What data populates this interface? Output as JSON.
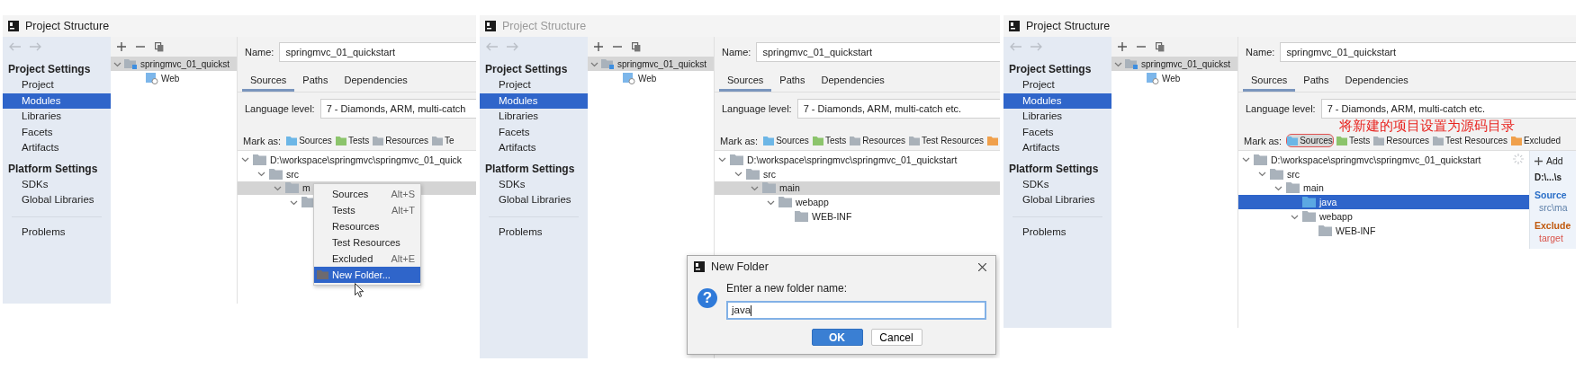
{
  "windows": [
    {
      "title": "Project Structure",
      "active": true,
      "tree_focused": false,
      "sidebar": {
        "sections": [
          {
            "heading": "Project Settings",
            "items": [
              {
                "label": "Project",
                "selected": false
              },
              {
                "label": "Modules",
                "selected": true
              },
              {
                "label": "Libraries",
                "selected": false
              },
              {
                "label": "Facets",
                "selected": false
              },
              {
                "label": "Artifacts",
                "selected": false
              }
            ]
          },
          {
            "heading": "Platform Settings",
            "items": [
              {
                "label": "SDKs",
                "selected": false
              },
              {
                "label": "Global Libraries",
                "selected": false
              }
            ]
          }
        ],
        "bottom_items": [
          {
            "label": "Problems",
            "selected": false
          }
        ]
      },
      "modules": [
        {
          "label": "springmvc_01_quickst",
          "kind": "module",
          "selected": true,
          "expanded": true,
          "children": [
            {
              "label": "Web",
              "kind": "web",
              "selected": false
            }
          ]
        }
      ],
      "name_label": "Name:",
      "name_value": "springmvc_01_quickstart",
      "tabs": [
        {
          "label": "Sources",
          "selected": true
        },
        {
          "label": "Paths",
          "selected": false
        },
        {
          "label": "Dependencies",
          "selected": false
        }
      ],
      "language_level_label": "Language level:",
      "language_level": "7 - Diamonds, ARM, multi-catch",
      "mark_as_label": "Mark as:",
      "mark_as": [
        {
          "label": "Sources",
          "color": "#6cb6e6",
          "circled": false
        },
        {
          "label": "Tests",
          "color": "#8cc46c",
          "circled": false
        },
        {
          "label": "Resources",
          "color": "#a9b1b9",
          "circled": false
        },
        {
          "label": "Te",
          "color": "#a9b1b9",
          "circled": false
        }
      ],
      "content_tree": [
        {
          "label": "D:\\workspace\\springmvc\\springmvc_01_quick",
          "kind": "folder",
          "expanded": true,
          "selected": false,
          "children": [
            {
              "label": "src",
              "kind": "folder",
              "expanded": true,
              "selected": false,
              "children": [
                {
                  "label": "m",
                  "kind": "folder",
                  "expanded": true,
                  "selected": true,
                  "children": [
                    {
                      "kind": "folder",
                      "expanded": true,
                      "selected": false
                    }
                  ]
                }
              ]
            }
          ]
        }
      ],
      "context_menu": {
        "items": [
          {
            "label": "Sources",
            "shortcut": "Alt+S",
            "kind": "mark",
            "selected": false
          },
          {
            "label": "Tests",
            "shortcut": "Alt+T",
            "kind": "mark",
            "selected": false
          },
          {
            "label": "Resources",
            "kind": "mark",
            "selected": false
          },
          {
            "label": "Test Resources",
            "kind": "mark",
            "selected": false
          },
          {
            "label": "Excluded",
            "shortcut": "Alt+E",
            "kind": "mark",
            "selected": false
          },
          {
            "label": "New Folder...",
            "kind": "create",
            "selected": true
          }
        ]
      }
    },
    {
      "title": "Project Structure",
      "active": false,
      "tree_focused": false,
      "sidebar": {
        "sections": [
          {
            "heading": "Project Settings",
            "items": [
              {
                "label": "Project",
                "selected": false
              },
              {
                "label": "Modules",
                "selected": true
              },
              {
                "label": "Libraries",
                "selected": false
              },
              {
                "label": "Facets",
                "selected": false
              },
              {
                "label": "Artifacts",
                "selected": false
              }
            ]
          },
          {
            "heading": "Platform Settings",
            "items": [
              {
                "label": "SDKs",
                "selected": false
              },
              {
                "label": "Global Libraries",
                "selected": false
              }
            ]
          }
        ],
        "bottom_items": [
          {
            "label": "Problems",
            "selected": false
          }
        ]
      },
      "modules": [
        {
          "label": "springmvc_01_quickst",
          "kind": "module",
          "selected": true,
          "expanded": true,
          "children": [
            {
              "label": "Web",
              "kind": "web",
              "selected": false
            }
          ]
        }
      ],
      "name_label": "Name:",
      "name_value": "springmvc_01_quickstart",
      "tabs": [
        {
          "label": "Sources",
          "selected": true
        },
        {
          "label": "Paths",
          "selected": false
        },
        {
          "label": "Dependencies",
          "selected": false
        }
      ],
      "language_level_label": "Language level:",
      "language_level": "7 - Diamonds, ARM, multi-catch etc.",
      "mark_as_label": "Mark as:",
      "mark_as": [
        {
          "label": "Sources",
          "color": "#6cb6e6",
          "circled": false
        },
        {
          "label": "Tests",
          "color": "#8cc46c",
          "circled": false
        },
        {
          "label": "Resources",
          "color": "#a9b1b9",
          "circled": false
        },
        {
          "label": "Test Resources",
          "color": "#a9b1b9",
          "circled": false
        },
        {
          "color": "#f0a04b",
          "circled": false
        }
      ],
      "content_tree": [
        {
          "label": "D:\\workspace\\springmvc\\springmvc_01_quickstart",
          "kind": "folder",
          "expanded": true,
          "selected": false,
          "children": [
            {
              "label": "src",
              "kind": "folder",
              "expanded": true,
              "selected": false,
              "children": [
                {
                  "label": "main",
                  "kind": "folder",
                  "expanded": true,
                  "selected": true,
                  "children": [
                    {
                      "label": "webapp",
                      "kind": "folder",
                      "expanded": true,
                      "selected": false,
                      "children": [
                        {
                          "label": "WEB-INF",
                          "kind": "folder",
                          "selected": false
                        }
                      ]
                    }
                  ]
                }
              ]
            }
          ]
        }
      ],
      "dialog": {
        "title": "New Folder",
        "icon": "?",
        "prompt": "Enter a new folder name:",
        "value": "java",
        "buttons": [
          {
            "label": "OK",
            "default": true
          },
          {
            "label": "Cancel",
            "default": false
          }
        ]
      }
    },
    {
      "title": "Project Structure",
      "active": true,
      "tree_focused": true,
      "busy": true,
      "sidebar": {
        "sections": [
          {
            "heading": "Project Settings",
            "items": [
              {
                "label": "Project",
                "selected": false
              },
              {
                "label": "Modules",
                "selected": true
              },
              {
                "label": "Libraries",
                "selected": false
              },
              {
                "label": "Facets",
                "selected": false
              },
              {
                "label": "Artifacts",
                "selected": false
              }
            ]
          },
          {
            "heading": "Platform Settings",
            "items": [
              {
                "label": "SDKs",
                "selected": false
              },
              {
                "label": "Global Libraries",
                "selected": false
              }
            ]
          }
        ],
        "bottom_items": [
          {
            "label": "Problems",
            "selected": false
          }
        ]
      },
      "modules": [
        {
          "label": "springmvc_01_quickst",
          "kind": "module",
          "selected": true,
          "expanded": true,
          "children": [
            {
              "label": "Web",
              "kind": "web",
              "selected": false
            }
          ]
        }
      ],
      "name_label": "Name:",
      "name_value": "springmvc_01_quickstart",
      "tabs": [
        {
          "label": "Sources",
          "selected": true
        },
        {
          "label": "Paths",
          "selected": false
        },
        {
          "label": "Dependencies",
          "selected": false
        }
      ],
      "language_level_label": "Language level:",
      "language_level": "7 - Diamonds, ARM, multi-catch etc.",
      "annotation": "将新建的项目设置为源码目录",
      "mark_as_label": "Mark as:",
      "mark_as": [
        {
          "label": "Sources",
          "color": "#6cb6e6",
          "circled": true
        },
        {
          "label": "Tests",
          "color": "#8cc46c",
          "circled": false
        },
        {
          "label": "Resources",
          "color": "#a9b1b9",
          "circled": false
        },
        {
          "label": "Test Resources",
          "color": "#a9b1b9",
          "circled": false
        },
        {
          "label": "Excluded",
          "color": "#f0a04b",
          "circled": false
        }
      ],
      "content_tree": [
        {
          "label": "D:\\workspace\\springmvc\\springmvc_01_quickstart",
          "kind": "folder",
          "expanded": true,
          "selected": false,
          "children": [
            {
              "label": "src",
              "kind": "folder",
              "expanded": true,
              "selected": false,
              "children": [
                {
                  "label": "main",
                  "kind": "folder",
                  "expanded": true,
                  "selected": false,
                  "children": [
                    {
                      "label": "java",
                      "kind": "sources",
                      "selected": true
                    },
                    {
                      "label": "webapp",
                      "kind": "folder",
                      "expanded": true,
                      "selected": false,
                      "children": [
                        {
                          "label": "WEB-INF",
                          "kind": "folder",
                          "selected": false
                        }
                      ]
                    }
                  ]
                }
              ]
            }
          ]
        }
      ],
      "side_panel": {
        "add_label": "Add",
        "root": "D:\\...\\s",
        "entries": [
          {
            "heading": "Source",
            "path": "src\\ma",
            "kind": "source"
          },
          {
            "heading": "Exclude",
            "path": "target",
            "kind": "excluded"
          }
        ]
      }
    }
  ]
}
